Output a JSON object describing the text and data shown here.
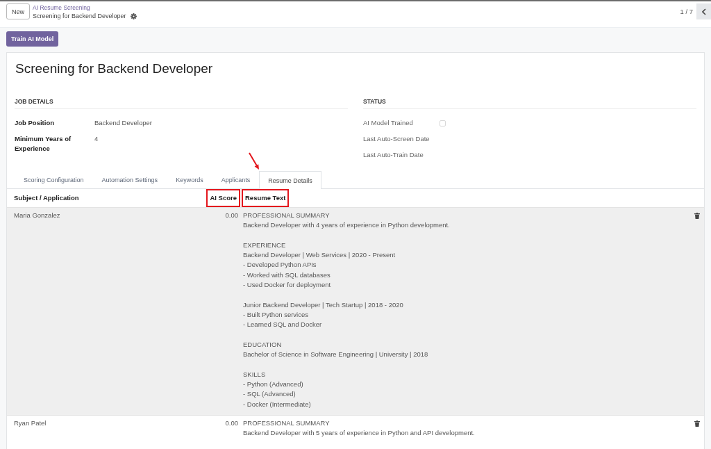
{
  "top_bar": {
    "new_button": "New",
    "breadcrumb": {
      "parent": "AI Resume Screening",
      "current": "Screening for Backend Developer"
    },
    "pager": "1 / 7"
  },
  "actions": [
    "Train AI Model"
  ],
  "record": {
    "title": "Screening for Backend Developer",
    "groups": [
      {
        "heading": "JOB DETAILS",
        "fields": [
          {
            "kind": "text",
            "label": "Job Position",
            "value": "Backend Developer",
            "readonly": false
          },
          {
            "kind": "text",
            "label": "Minimum Years of Experience",
            "value": "4",
            "readonly": false
          }
        ]
      },
      {
        "heading": "STATUS",
        "fields": [
          {
            "kind": "checkbox",
            "label": "AI Model Trained",
            "checked": false,
            "readonly": true
          },
          {
            "kind": "date",
            "label": "Last Auto-Screen Date",
            "readonly": true
          },
          {
            "kind": "date",
            "label": "Last Auto-Train Date",
            "readonly": true
          }
        ]
      }
    ]
  },
  "tabs": [
    {
      "label": "Scoring Configuration",
      "selected": false,
      "pointed": false
    },
    {
      "label": "Automation Settings",
      "selected": false,
      "pointed": false
    },
    {
      "label": "Keywords",
      "selected": false,
      "pointed": false
    },
    {
      "label": "Applicants",
      "selected": false,
      "pointed": false
    },
    {
      "label": "Resume Details",
      "selected": true,
      "pointed": true
    }
  ],
  "table": {
    "columns": [
      {
        "kind": "text",
        "label": "Subject / Application",
        "highlighted": false
      },
      {
        "kind": "number",
        "label": "AI Score",
        "highlighted": true
      },
      {
        "kind": "multiline",
        "label": "Resume Text",
        "highlighted": true
      }
    ],
    "rows": [
      {
        "selected": true,
        "cells": [
          "Maria Gonzalez",
          "0.00",
          "PROFESSIONAL SUMMARY\nBackend Developer with 4 years of experience in Python development.\n\nEXPERIENCE\nBackend Developer | Web Services | 2020 - Present\n- Developed Python APIs\n- Worked with SQL databases\n- Used Docker for deployment\n\nJunior Backend Developer | Tech Startup | 2018 - 2020\n- Built Python services\n- Learned SQL and Docker\n\nEDUCATION\nBachelor of Science in Software Engineering | University | 2018\n\nSKILLS\n- Python (Advanced)\n- SQL (Advanced)\n- Docker (Intermediate)"
        ]
      },
      {
        "selected": false,
        "cells": [
          "Ryan Patel",
          "0.00",
          "PROFESSIONAL SUMMARY\nBackend Developer with 5 years of experience in Python and API development."
        ]
      }
    ]
  }
}
